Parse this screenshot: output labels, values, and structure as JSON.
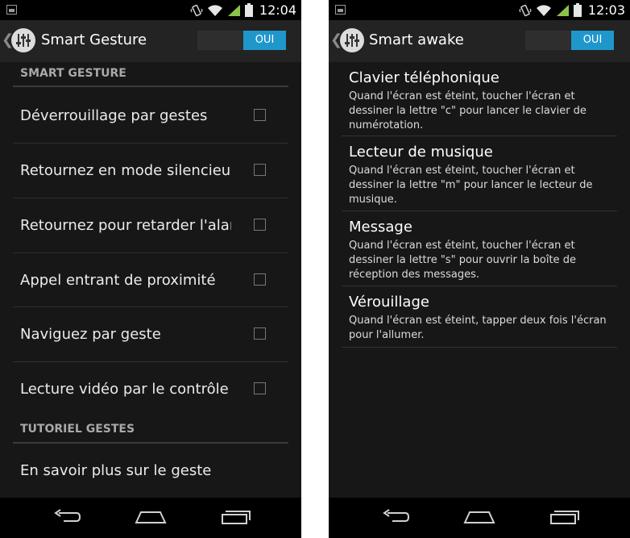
{
  "left": {
    "status_time": "12:04",
    "title": "Smart Gesture",
    "toggle_label": "OUI",
    "sections": [
      {
        "header": "SMART GESTURE",
        "items": [
          {
            "label": "Déverrouillage par gestes",
            "checked": false
          },
          {
            "label": "Retournez en mode silencieux",
            "checked": false
          },
          {
            "label": "Retournez pour retarder l'alarme",
            "checked": false
          },
          {
            "label": "Appel entrant de proximité",
            "checked": false
          },
          {
            "label": "Naviguez par geste",
            "checked": false
          },
          {
            "label": "Lecture vidéo par le contrôle de",
            "checked": false
          }
        ]
      },
      {
        "header": "TUTORIEL GESTES",
        "items": [
          {
            "label": "En savoir plus sur le geste"
          }
        ]
      }
    ]
  },
  "right": {
    "status_time": "12:03",
    "title": "Smart awake",
    "toggle_label": "OUI",
    "items": [
      {
        "title": "Clavier téléphonique",
        "desc": "Quand l'écran est éteint, toucher l'écran et dessiner la lettre \"c\" pour lancer le clavier de numérotation."
      },
      {
        "title": "Lecteur de musique",
        "desc": "Quand l'écran est éteint, toucher l'écran et dessiner la lettre \"m\" pour lancer le lecteur de musique."
      },
      {
        "title": "Message",
        "desc": "Quand l'écran est éteint, toucher l'écran et dessiner la lettre \"s\" pour ouvrir la boîte de réception des messages."
      },
      {
        "title": "Vérouillage",
        "desc": "Quand l'écran est éteint, tapper deux fois l'écran pour l'allumer."
      }
    ]
  },
  "colors": {
    "accent": "#2097cb",
    "signal": "#8bc34a",
    "background": "#171717",
    "action_bar": "#232323"
  },
  "icons": [
    "notification-image-icon",
    "vibrate-icon",
    "wifi-icon",
    "signal-icon",
    "battery-icon",
    "equalizer-app-icon",
    "back-icon",
    "home-icon",
    "recents-icon"
  ]
}
